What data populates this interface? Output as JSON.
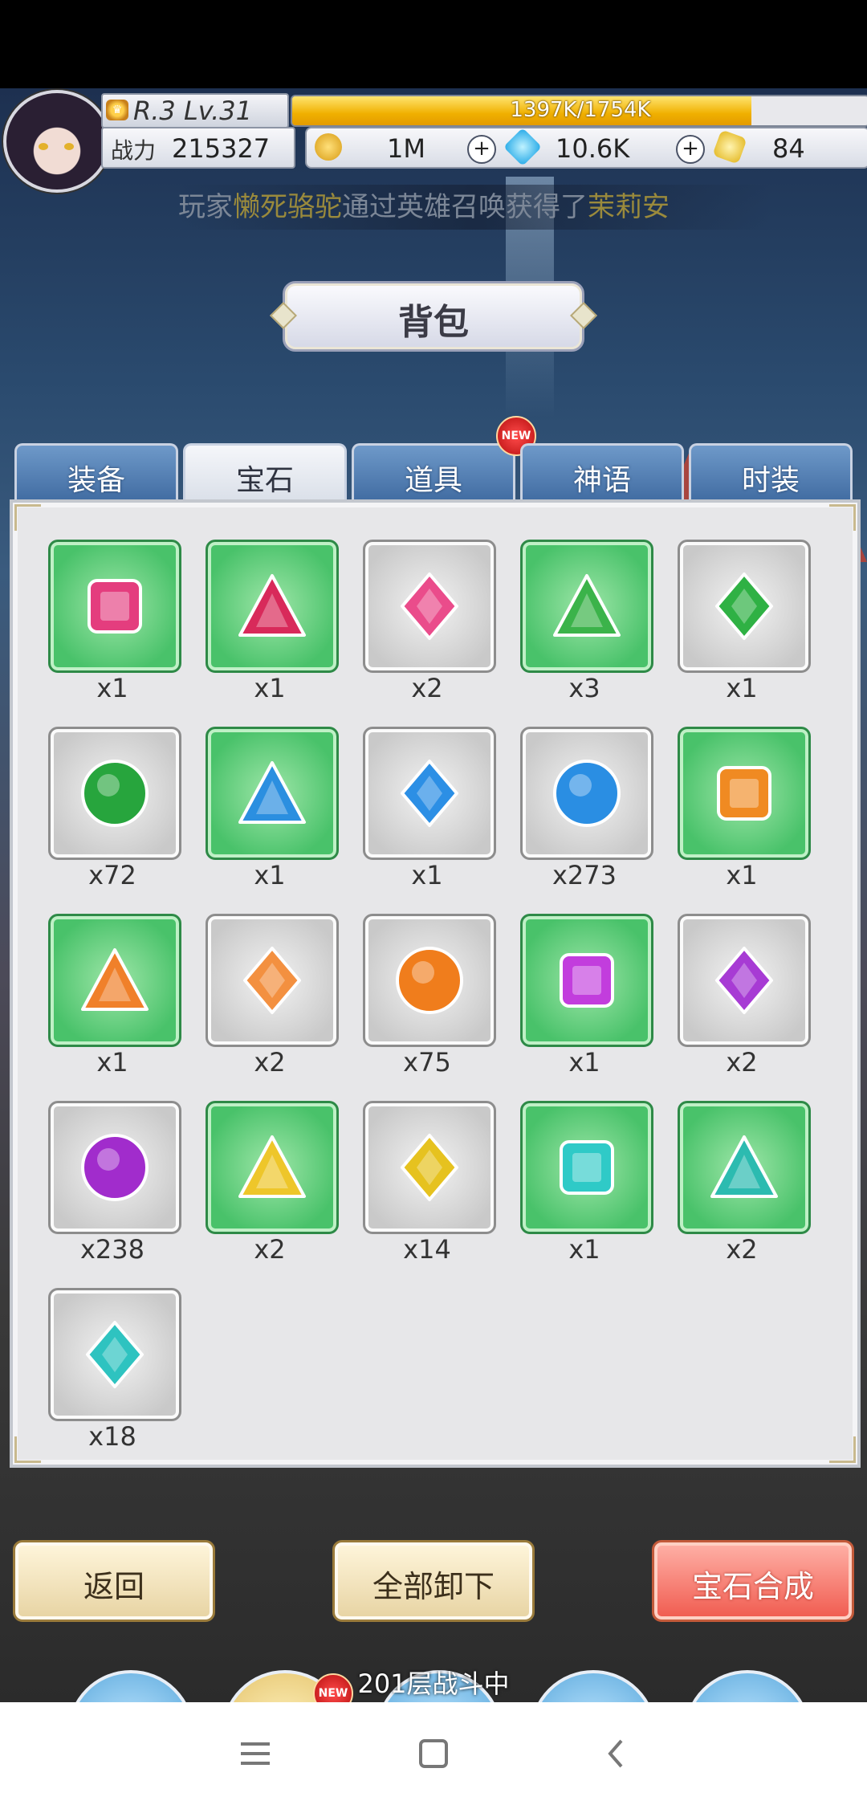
{
  "header": {
    "rank": "R.3 Lv.31",
    "exp_text": "1397K/1754K",
    "exp_fraction": 0.797,
    "power_label": "战力",
    "power_value": "215327",
    "gold": "1M",
    "diamonds": "10.6K",
    "crystals": "84"
  },
  "notice": {
    "prefix": "玩家",
    "player": "懒死骆驼",
    "middle": "通过英雄召唤获得了",
    "hero": "茉莉安"
  },
  "title": "背包",
  "tabs": [
    {
      "label": "装备",
      "active": false
    },
    {
      "label": "宝石",
      "active": true
    },
    {
      "label": "道具",
      "active": false,
      "badge": "NEW"
    },
    {
      "label": "神语",
      "active": false
    },
    {
      "label": "时装",
      "active": false
    }
  ],
  "gems": [
    {
      "shape": "square",
      "color": "#e43d7e",
      "bg": "green",
      "qty": "x1"
    },
    {
      "shape": "triangle",
      "color": "#d82a5a",
      "bg": "green",
      "qty": "x1"
    },
    {
      "shape": "diamond",
      "color": "#ea4c8b",
      "bg": "grey",
      "qty": "x2"
    },
    {
      "shape": "triangle",
      "color": "#3bb34a",
      "bg": "green",
      "qty": "x3"
    },
    {
      "shape": "diamond",
      "color": "#2fb144",
      "bg": "grey",
      "qty": "x1"
    },
    {
      "shape": "circle",
      "color": "#27a53d",
      "bg": "grey",
      "qty": "x72"
    },
    {
      "shape": "triangle",
      "color": "#2b8fe0",
      "bg": "green",
      "qty": "x1"
    },
    {
      "shape": "diamond",
      "color": "#2c8fe5",
      "bg": "grey",
      "qty": "x1"
    },
    {
      "shape": "circle",
      "color": "#2a8ee3",
      "bg": "grey",
      "qty": "x273"
    },
    {
      "shape": "square",
      "color": "#f08a22",
      "bg": "green",
      "qty": "x1"
    },
    {
      "shape": "triangle",
      "color": "#f0802a",
      "bg": "green",
      "qty": "x1"
    },
    {
      "shape": "diamond",
      "color": "#f39040",
      "bg": "grey",
      "qty": "x2"
    },
    {
      "shape": "circle",
      "color": "#f07d1c",
      "bg": "grey",
      "qty": "x75"
    },
    {
      "shape": "square",
      "color": "#c23ddd",
      "bg": "green",
      "qty": "x1"
    },
    {
      "shape": "diamond",
      "color": "#a73bd4",
      "bg": "grey",
      "qty": "x2"
    },
    {
      "shape": "circle",
      "color": "#a12ccc",
      "bg": "grey",
      "qty": "x238"
    },
    {
      "shape": "triangle",
      "color": "#eec62a",
      "bg": "green",
      "qty": "x2"
    },
    {
      "shape": "diamond",
      "color": "#e6c21f",
      "bg": "grey",
      "qty": "x14"
    },
    {
      "shape": "square",
      "color": "#2fcac7",
      "bg": "green",
      "qty": "x1"
    },
    {
      "shape": "triangle",
      "color": "#2cbbb0",
      "bg": "green",
      "qty": "x2"
    },
    {
      "shape": "diamond",
      "color": "#2ec3c0",
      "bg": "grey",
      "qty": "x18"
    }
  ],
  "buttons": {
    "back": "返回",
    "unequip_all": "全部卸下",
    "gem_merge": "宝石合成"
  },
  "floor_status": "201层战斗中",
  "dock_badge": "NEW",
  "colors": {
    "tab_blue": "#4f7cb3",
    "slot_green": "#49c26a",
    "merge_red": "#f05a4e"
  }
}
